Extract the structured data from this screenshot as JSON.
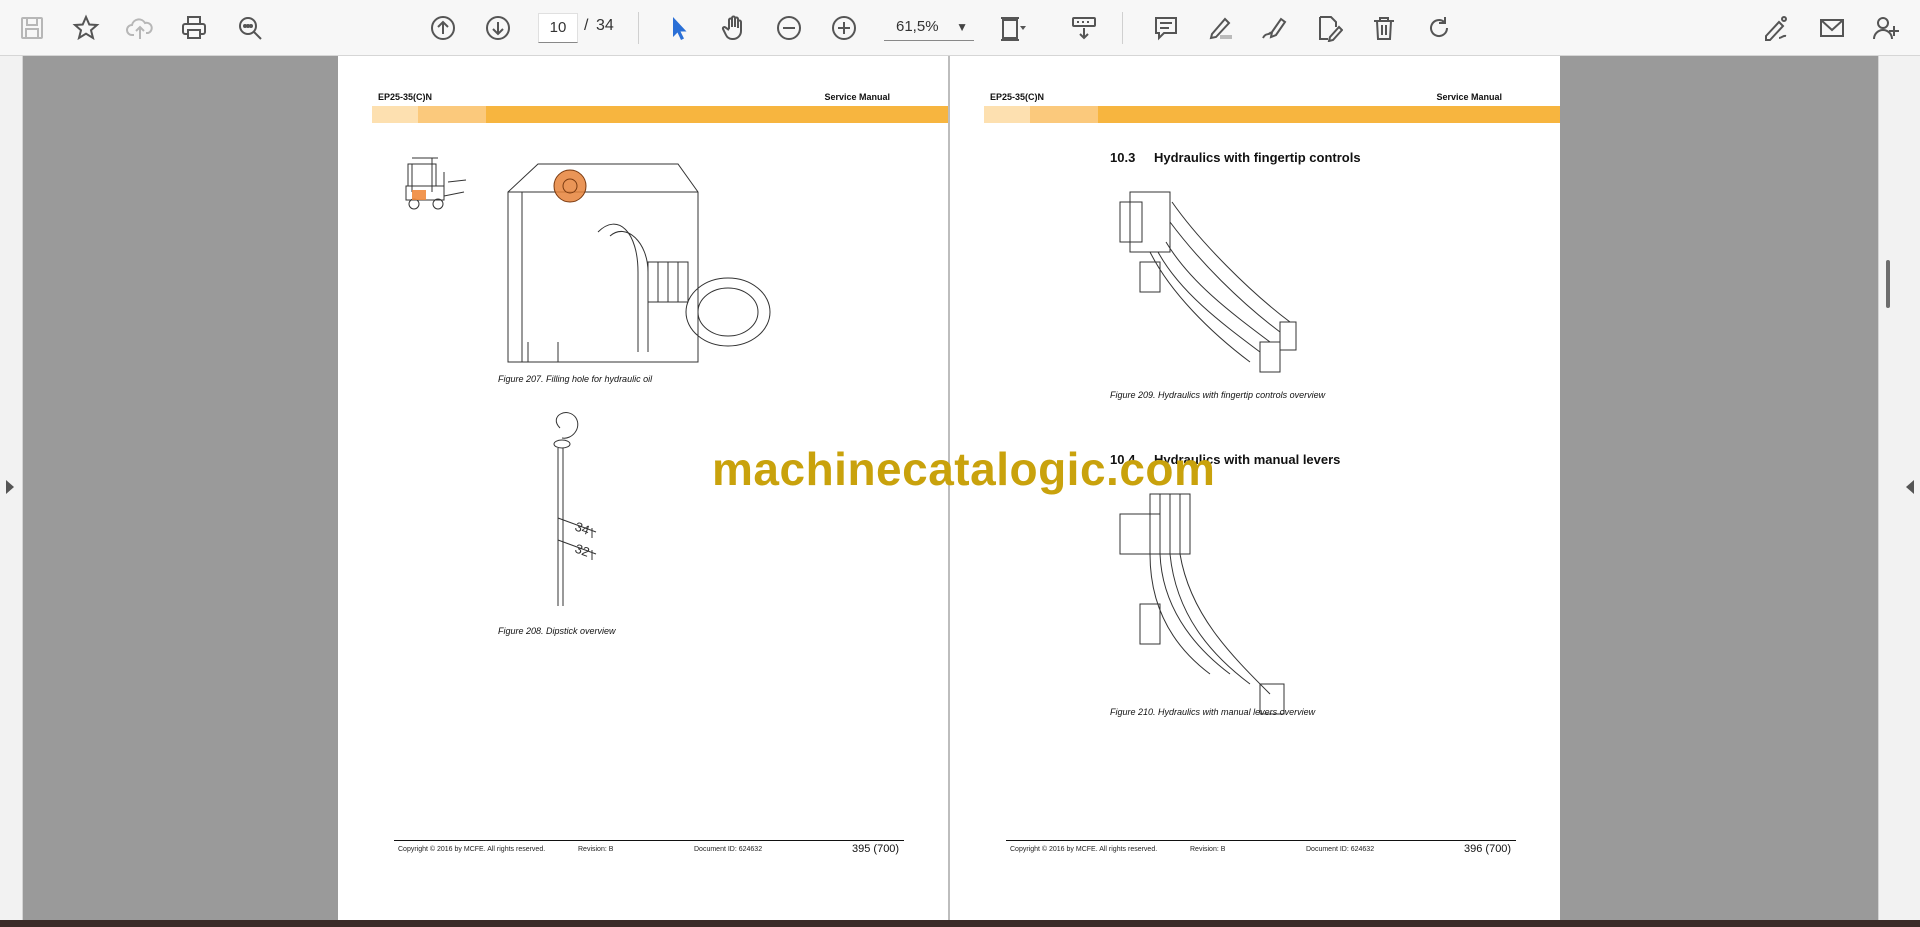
{
  "toolbar": {
    "current_page": "10",
    "page_separator": "/",
    "total_pages": "34",
    "zoom": "61,5%"
  },
  "left_page": {
    "header_left": "EP25-35(C)N",
    "header_right": "Service Manual",
    "fig207_caption": "Figure 207. Filling hole for hydraulic oil",
    "fig208_caption": "Figure 208. Dipstick overview",
    "dipstick_mark_top": "34",
    "dipstick_mark_bottom": "32",
    "copyright": "Copyright © 2016 by MCFE. All rights reserved.",
    "revision": "Revision: B",
    "document_id": "Document ID: 624632",
    "page_number": "395 (700)"
  },
  "right_page": {
    "header_left": "EP25-35(C)N",
    "header_right": "Service Manual",
    "section_10_3_number": "10.3",
    "section_10_3_title": "Hydraulics with fingertip controls",
    "fig209_caption": "Figure 209. Hydraulics with fingertip controls overview",
    "section_10_4_number": "10.4",
    "section_10_4_title": "Hydraulics with manual levers",
    "fig210_caption": "Figure 210. Hydraulics with manual levers overview",
    "copyright": "Copyright © 2016 by MCFE. All rights reserved.",
    "revision": "Revision: B",
    "document_id": "Document ID: 624632",
    "page_number": "396 (700)"
  },
  "watermark": "machinecatalogic.com"
}
